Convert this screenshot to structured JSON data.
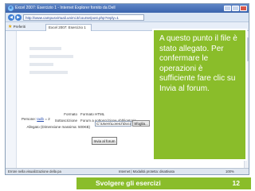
{
  "browser": {
    "window_title": "Excel 2007: Esercizio 1 - Internet Explorer fornito da Dell",
    "address": "http://www.campusvirtuali.unimi.it/course/post.php?reply=1",
    "favorites_label": "Preferiti",
    "tab_label": "Excel 2007: Esercizio 1",
    "status_left": "Errore nella visualizzazione della pa",
    "status_mid": "Internet | Modalità protetta: disattivata",
    "zoom": "100%"
  },
  "page": {
    "persone_label": "Persone:",
    "persone_link": "tadb",
    "persone_suffix": "= 2",
    "formato_label": "Formato",
    "formato_value": "Formato HTML",
    "sottoscrizione_label": "Sottoscrizione",
    "sottoscrizione_value": "Forum a sottoscrizione obbligatoria",
    "allegato_label": "Allegato (Dimensione massima: 500KB)",
    "allegato_path": "C:\\Users\\Lorenz\\Documen",
    "browse_label": "Sfoglia...",
    "submit_label": "Invia al forum"
  },
  "callout": {
    "text": "A questo punto il file è stato allegato. Per confermare le operazioni è sufficiente fare clic su Invia al forum."
  },
  "footer": {
    "title": "Svolgere gli esercizi",
    "page_number": "12"
  },
  "colors": {
    "accent_green": "#8abd2a",
    "ie_blue": "#3a63ad"
  }
}
